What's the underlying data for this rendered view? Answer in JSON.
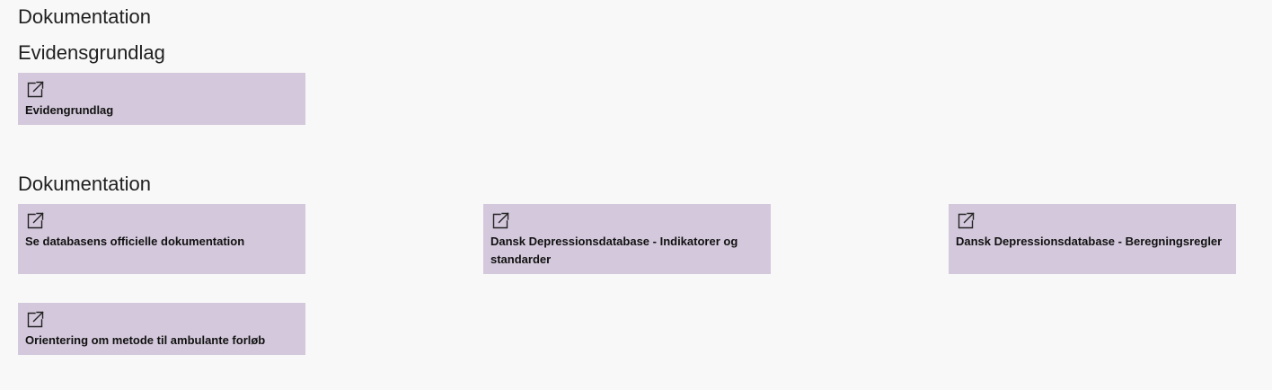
{
  "page": {
    "title": "Dokumentation"
  },
  "sections": {
    "evidens": {
      "title": "Evidensgrundlag",
      "tiles": [
        {
          "label": "Evidengrundlag",
          "icon": "external-link-icon"
        }
      ]
    },
    "dokumentation": {
      "title": "Dokumentation",
      "tiles": [
        {
          "label": "Se databasens officielle dokumentation",
          "icon": "external-link-icon"
        },
        {
          "label": "Dansk Depressionsdatabase - Indikatorer og standarder",
          "icon": "external-link-icon"
        },
        {
          "label": "Dansk Depressionsdatabase - Beregningsregler",
          "icon": "external-link-icon"
        },
        {
          "label": "Orientering om metode til ambulante forløb",
          "icon": "external-link-icon"
        }
      ]
    }
  },
  "colors": {
    "background": "#f8f8f8",
    "tile_background": "#d4c9dc",
    "text": "#1f1f1f"
  }
}
